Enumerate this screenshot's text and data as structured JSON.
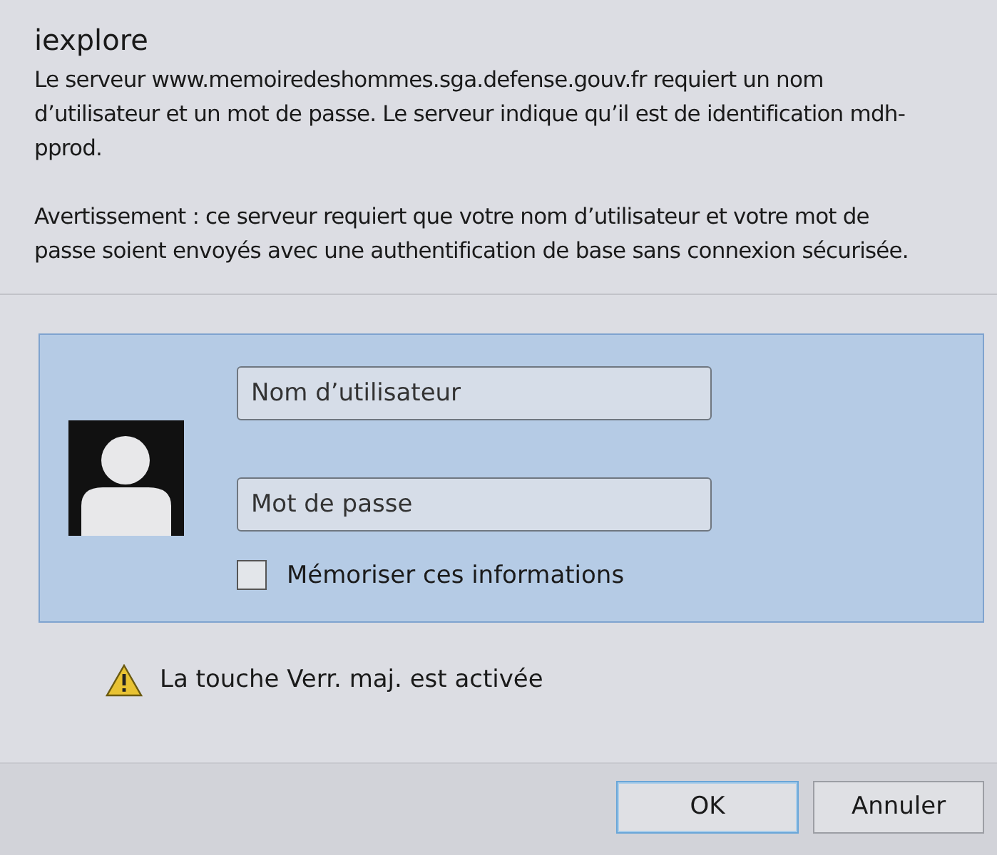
{
  "window": {
    "title": "iexplore"
  },
  "message": "Le serveur www.memoiredeshommes.sga.defense.gouv.fr requiert un nom d’utilisateur et un mot de passe. Le serveur indique qu’il est de identification mdh-pprod.",
  "warning": "Avertissement : ce serveur requiert que votre nom d’utilisateur et votre mot de passe soient envoyés avec une authentification de base sans connexion sécurisée.",
  "credentials": {
    "username": {
      "placeholder": "Nom d’utilisateur"
    },
    "password": {
      "placeholder": "Mot de passe"
    },
    "remember": {
      "label": "Mémoriser ces informations",
      "checked": false
    }
  },
  "caps_lock": {
    "text": "La touche Verr. maj. est activée"
  },
  "buttons": [
    {
      "label": "OK",
      "default": true
    },
    {
      "label": "Annuler",
      "default": false
    }
  ]
}
